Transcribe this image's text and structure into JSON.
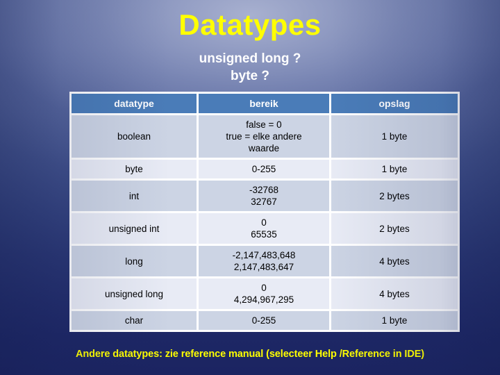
{
  "slide": {
    "title": "Datatypes",
    "subtitle_lines": [
      "unsigned long ?",
      "byte ?"
    ],
    "footer": "Andere datatypes: zie reference manual (selecteer Help /Reference in IDE)",
    "colors": {
      "title": "#ffff00",
      "subtitle": "#ffffff",
      "footer": "#ffff00",
      "table_header_bg": "#4a7cb8",
      "row_even_bg": "#ccd4e4",
      "row_odd_bg": "#e8ebf5",
      "background_top": "#5e6ea4",
      "background_bottom": "#1b2461"
    }
  },
  "table": {
    "headers": [
      "datatype",
      "bereik",
      "opslag"
    ],
    "rows": [
      {
        "datatype": "boolean",
        "bereik": [
          "false = 0",
          "true = elke andere",
          "waarde"
        ],
        "opslag": "1 byte"
      },
      {
        "datatype": "byte",
        "bereik": [
          "0-255"
        ],
        "opslag": "1 byte"
      },
      {
        "datatype": "int",
        "bereik": [
          "-32768",
          "32767"
        ],
        "opslag": "2 bytes"
      },
      {
        "datatype": "unsigned int",
        "bereik": [
          "0",
          "65535"
        ],
        "opslag": "2 bytes"
      },
      {
        "datatype": "long",
        "bereik": [
          "-2,147,483,648",
          "2,147,483,647"
        ],
        "opslag": "4 bytes"
      },
      {
        "datatype": "unsigned long",
        "bereik": [
          "0",
          "4,294,967,295"
        ],
        "opslag": "4 bytes"
      },
      {
        "datatype": "char",
        "bereik": [
          "0-255"
        ],
        "opslag": "1 byte"
      }
    ]
  }
}
